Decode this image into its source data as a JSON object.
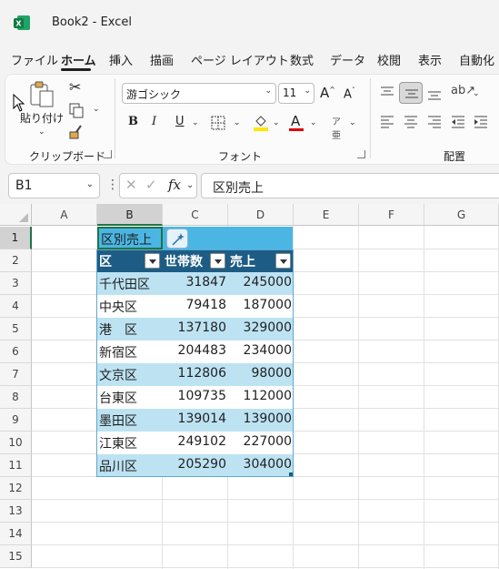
{
  "app": {
    "title": "Book2 - Excel"
  },
  "tabs": [
    "ファイル",
    "ホーム",
    "挿入",
    "描画",
    "ページ レイアウト",
    "数式",
    "データ",
    "校閲",
    "表示",
    "自動化"
  ],
  "active_tab": "ホーム",
  "ribbon": {
    "clipboard": {
      "paste_label": "貼り付け",
      "group_label": "クリップボード"
    },
    "font": {
      "font_name": "游ゴシック",
      "font_size": "11",
      "group_label": "フォント"
    },
    "alignment": {
      "group_label": "配置"
    }
  },
  "formula_bar": {
    "name_box": "B1",
    "formula": "区別売上",
    "fx_label": "fx"
  },
  "columns": [
    "A",
    "B",
    "C",
    "D",
    "E",
    "F",
    "G"
  ],
  "rows": [
    "1",
    "2",
    "3",
    "4",
    "5",
    "6",
    "7",
    "8",
    "9",
    "10",
    "11",
    "12",
    "13",
    "14",
    "15"
  ],
  "table": {
    "title": "区別売上",
    "headers": [
      "区",
      "世帯数",
      "売上"
    ],
    "rows": [
      [
        "千代田区",
        "31847",
        "245000"
      ],
      [
        "中央区",
        "79418",
        "187000"
      ],
      [
        "港　区",
        "137180",
        "329000"
      ],
      [
        "新宿区",
        "204483",
        "234000"
      ],
      [
        "文京区",
        "112806",
        "98000"
      ],
      [
        "台東区",
        "109735",
        "112000"
      ],
      [
        "墨田区",
        "139014",
        "139000"
      ],
      [
        "江東区",
        "249102",
        "227000"
      ],
      [
        "品川区",
        "205290",
        "304000"
      ]
    ]
  },
  "colors": {
    "excel_green": "#217346",
    "table_header": "#1d5c84",
    "table_band": "#bde3f3",
    "table_title": "#4bb6e3"
  }
}
